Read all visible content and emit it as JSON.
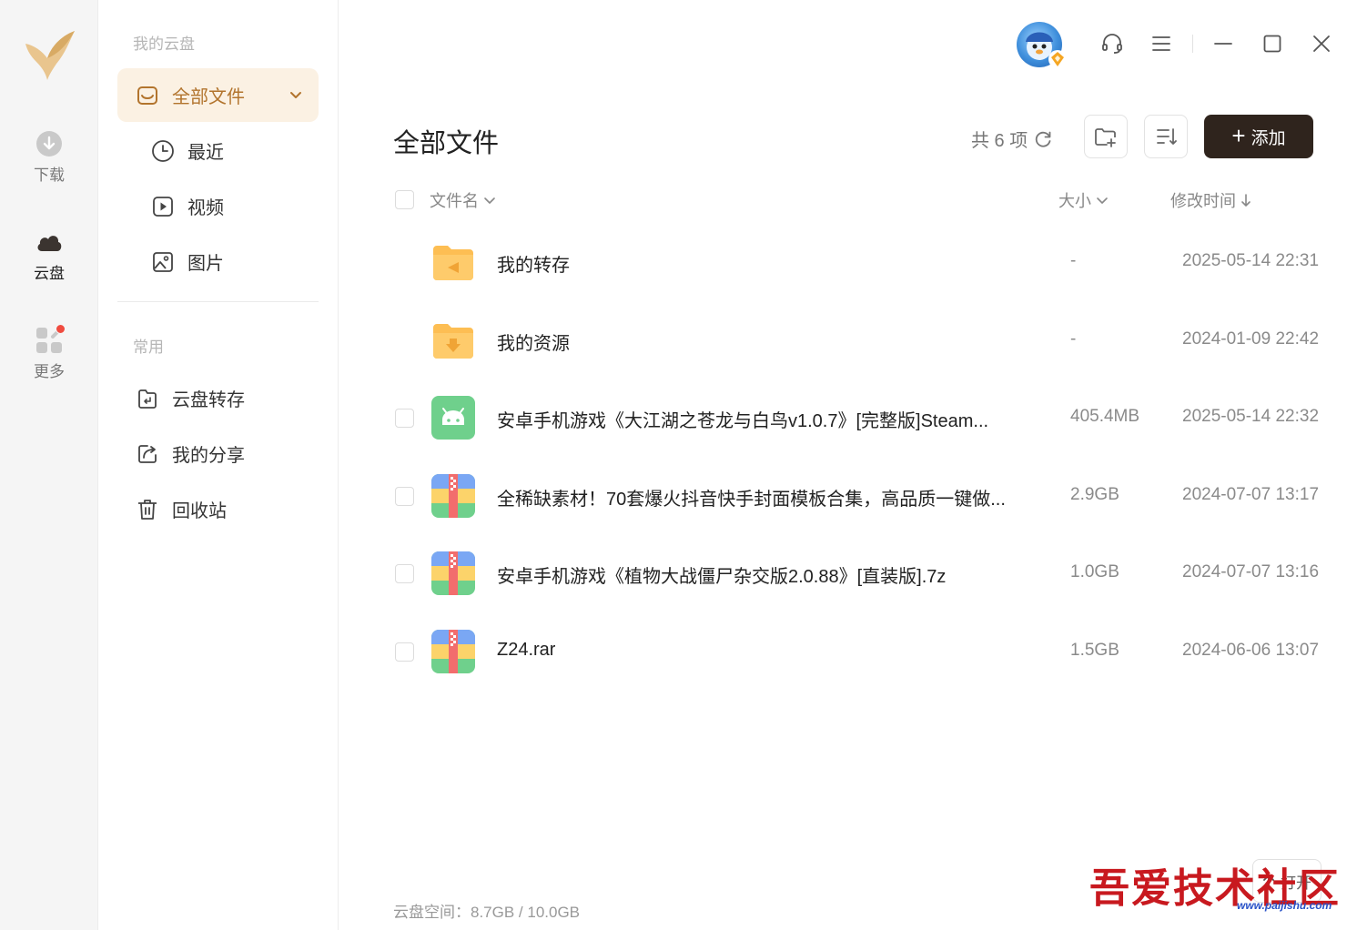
{
  "rail": {
    "items": [
      {
        "label": "下载",
        "icon": "download-icon"
      },
      {
        "label": "云盘",
        "icon": "cloud-icon"
      },
      {
        "label": "更多",
        "icon": "apps-icon"
      }
    ]
  },
  "sidebar": {
    "section_cloud": "我的云盘",
    "items": [
      {
        "label": "全部文件",
        "icon": "folder-inbox-icon"
      },
      {
        "label": "最近",
        "icon": "clock-icon"
      },
      {
        "label": "视频",
        "icon": "play-icon"
      },
      {
        "label": "图片",
        "icon": "image-icon"
      }
    ],
    "section_common": "常用",
    "common_items": [
      {
        "label": "云盘转存",
        "icon": "transfer-icon"
      },
      {
        "label": "我的分享",
        "icon": "share-icon"
      },
      {
        "label": "回收站",
        "icon": "trash-icon"
      }
    ]
  },
  "main": {
    "title": "全部文件",
    "count": "共 6 项",
    "add_label": "添加",
    "columns": {
      "name": "文件名",
      "size": "大小",
      "modified": "修改时间"
    },
    "files": [
      {
        "name": "我的转存",
        "size": "-",
        "date": "2025-05-14 22:31",
        "type": "folder-transfer"
      },
      {
        "name": "我的资源",
        "size": "-",
        "date": "2024-01-09 22:42",
        "type": "folder-download"
      },
      {
        "name": "安卓手机游戏《大江湖之苍龙与白鸟v1.0.7》[完整版]Steam...",
        "size": "405.4MB",
        "date": "2025-05-14 22:32",
        "type": "apk"
      },
      {
        "name": "全稀缺素材！70套爆火抖音快手封面模板合集，高品质一键做...",
        "size": "2.9GB",
        "date": "2024-07-07 13:17",
        "type": "archive"
      },
      {
        "name": "安卓手机游戏《植物大战僵尸杂交版2.0.88》[直装版].7z",
        "size": "1.0GB",
        "date": "2024-07-07 13:16",
        "type": "archive"
      },
      {
        "name": "Z24.rar",
        "size": "1.5GB",
        "date": "2024-06-06 13:07",
        "type": "archive"
      }
    ],
    "storage": "云盘空间：8.7GB / 10.0GB"
  },
  "watermark": {
    "text": "吾爱技术社区",
    "url": "www.paijishu.com"
  },
  "float_button": {
    "label": "打开"
  },
  "colors": {
    "accent": "#b2742d",
    "active_bg": "#fbf1e3",
    "add_button": "#2f241d",
    "folder": "#fdbe53"
  }
}
